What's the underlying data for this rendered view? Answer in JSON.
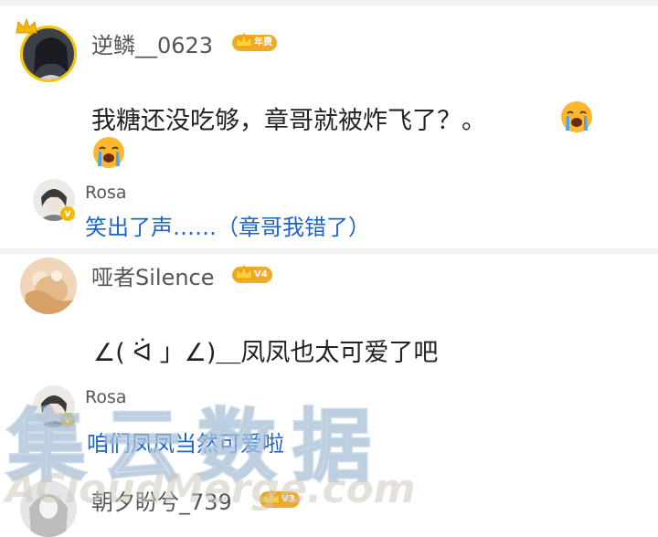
{
  "comments": [
    {
      "username": "逆鳞__0623",
      "badge": "年费",
      "text_line1": "我糖还没吃够，章哥就被炸飞了？。",
      "emoji": "crying-emoji"
    },
    {
      "username": "Rosa",
      "text": "笑出了声……（章哥我错了）",
      "is_reply": true
    },
    {
      "username": "哑者Silence",
      "badge": "V4",
      "text": "∠( ᐛ 」∠)＿凤凤也太可爱了吧"
    },
    {
      "username": "Rosa",
      "text": "咱们凤凤当然可爱啦",
      "is_reply": true
    },
    {
      "username": "朝夕盼兮_739",
      "badge": "V3"
    }
  ],
  "watermark": {
    "cn": "集云数据",
    "en": "ACloudMerge.com"
  },
  "colors": {
    "reply_text": "#1e63c8",
    "badge": "#f2a928",
    "crown": "#f6b800"
  }
}
